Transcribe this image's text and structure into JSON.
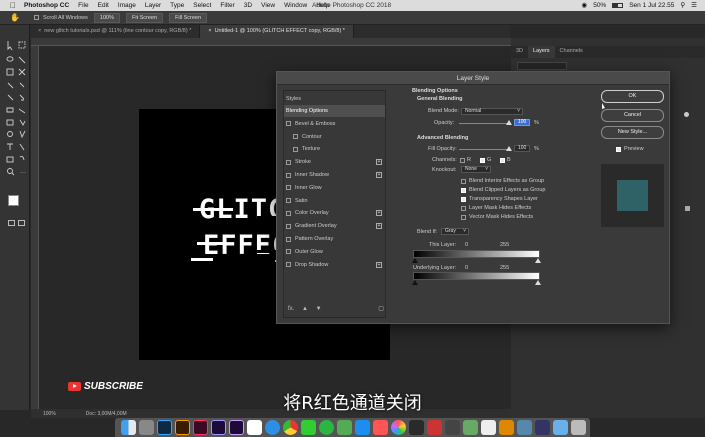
{
  "menubar": {
    "app": "Photoshop CC",
    "items": [
      "File",
      "Edit",
      "Image",
      "Layer",
      "Type",
      "Select",
      "Filter",
      "3D",
      "View",
      "Window",
      "Help"
    ],
    "window_title": "Adobe Photoshop CC 2018",
    "battery": "50%",
    "clock": "Sen 1 Jul  22.55"
  },
  "options": {
    "scroll_all": "Scroll All Windows",
    "zoom": "100%",
    "fit_screen": "Fit Screen",
    "fill_screen": "Fill Screen"
  },
  "tabs": [
    "new glitch tutorials.psd @ 111% (line contour copy, RGB/8) *",
    "Untitled-1 @ 100% (GLITCH EFFECT copy, RGB/8) *"
  ],
  "status": {
    "zoom": "100%",
    "doc": "Doc: 3,00M/4,00M"
  },
  "right_panel": {
    "tabs": [
      "3D",
      "Layers",
      "Channels"
    ]
  },
  "glitch_text": {
    "line1": "GLITCH",
    "line2": "EFFECT"
  },
  "dialog": {
    "title": "Layer Style",
    "styles_header": "Styles",
    "styles": [
      {
        "label": "Blending Options",
        "checkbox": false,
        "plus": false,
        "selected": true
      },
      {
        "label": "Bevel & Emboss",
        "checkbox": true,
        "plus": false
      },
      {
        "label": "Contour",
        "checkbox": true,
        "plus": false,
        "indent": true
      },
      {
        "label": "Texture",
        "checkbox": true,
        "plus": false,
        "indent": true
      },
      {
        "label": "Stroke",
        "checkbox": true,
        "plus": true
      },
      {
        "label": "Inner Shadow",
        "checkbox": true,
        "plus": true
      },
      {
        "label": "Inner Glow",
        "checkbox": true,
        "plus": false
      },
      {
        "label": "Satin",
        "checkbox": true,
        "plus": false
      },
      {
        "label": "Color Overlay",
        "checkbox": true,
        "plus": true
      },
      {
        "label": "Gradient Overlay",
        "checkbox": true,
        "plus": true
      },
      {
        "label": "Pattern Overlay",
        "checkbox": true,
        "plus": false
      },
      {
        "label": "Outer Glow",
        "checkbox": true,
        "plus": false
      },
      {
        "label": "Drop Shadow",
        "checkbox": true,
        "plus": true
      }
    ],
    "footer_fx": "fx.",
    "blending": {
      "section_title": "Blending Options",
      "general_title": "General Blending",
      "blend_mode_label": "Blend Mode:",
      "blend_mode_value": "Normal",
      "opacity_label": "Opacity:",
      "opacity_value": "100",
      "percent": "%",
      "advanced_title": "Advanced Blending",
      "fill_opacity_label": "Fill Opacity:",
      "fill_opacity_value": "100",
      "channels_label": "Channels:",
      "channel_r": "R",
      "channel_g": "G",
      "channel_b": "B",
      "knockout_label": "Knockout:",
      "knockout_value": "None",
      "options": [
        {
          "label": "Blend Interior Effects as Group",
          "checked": false
        },
        {
          "label": "Blend Clipped Layers as Group",
          "checked": true
        },
        {
          "label": "Transparency Shapes Layer",
          "checked": true
        },
        {
          "label": "Layer Mask Hides Effects",
          "checked": false
        },
        {
          "label": "Vector Mask Hides Effects",
          "checked": false
        }
      ],
      "blend_if_label": "Blend If:",
      "blend_if_value": "Gray",
      "this_layer_label": "This Layer:",
      "this_layer_min": "0",
      "this_layer_max": "255",
      "underlying_label": "Underlying Layer:",
      "underlying_min": "0",
      "underlying_max": "255"
    },
    "buttons": {
      "ok": "OK",
      "cancel": "Cancel",
      "new_style": "New Style..."
    },
    "preview_label": "Preview"
  },
  "overlay": {
    "subscribe": "SUBSCRIBE",
    "subtitle": "将R红色通道关闭"
  },
  "colors": {
    "dialog_bg": "#3a3a3a",
    "highlight": "#3b6fd6",
    "preview_swatch": "#2f6266",
    "youtube_red": "#ee3333"
  }
}
